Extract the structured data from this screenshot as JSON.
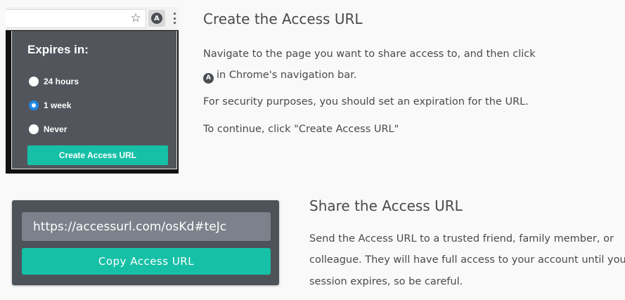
{
  "browser": {
    "star_glyph": "☆",
    "extension_glyph": "A",
    "icons": [
      "star-icon",
      "access-url-extension-icon",
      "kebab-menu-icon"
    ]
  },
  "popup": {
    "title": "Expires in:",
    "options": [
      {
        "label": "24 hours",
        "checked": false
      },
      {
        "label": "1 week",
        "checked": true
      },
      {
        "label": "Never",
        "checked": false
      }
    ],
    "button_label": "Create Access URL",
    "accent_color": "#16c0a6",
    "radio_selected_color": "#1e88e5"
  },
  "section_create": {
    "heading": "Create the Access URL",
    "line1": "Navigate to the page you want to share access to, and then click",
    "line2_icon": "A",
    "line2_text": "in Chrome's navigation bar.",
    "line3": "For security purposes, you should set an expiration for the URL.",
    "line4": "To continue, click \"Create Access URL\""
  },
  "share_card": {
    "url_value": "https://accessurl.com/osKd#teJc",
    "copy_label": "Copy Access URL"
  },
  "section_share": {
    "heading": "Share the Access URL",
    "line1": "Send the Access URL to a trusted friend, family member, or",
    "line2": "colleague. They will have full access to your account until your",
    "line3": "session expires, so be careful."
  }
}
